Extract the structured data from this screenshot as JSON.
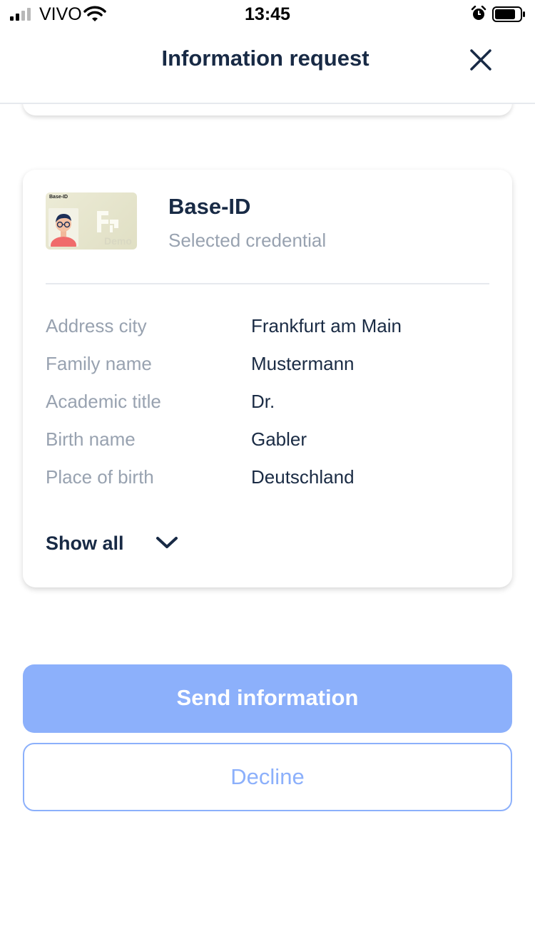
{
  "status_bar": {
    "carrier": "VIVO",
    "time": "13:45",
    "signal_bars_active": 2,
    "signal_bars_total": 4,
    "battery_level": 0.75
  },
  "header": {
    "title": "Information request",
    "close_icon": "close-icon"
  },
  "credential": {
    "thumbnail": {
      "label": "Base-ID",
      "watermark": "Demo"
    },
    "name": "Base-ID",
    "subtitle": "Selected credential",
    "attributes": [
      {
        "label": "Address city",
        "value": "Frankfurt am Main"
      },
      {
        "label": "Family name",
        "value": "Mustermann"
      },
      {
        "label": "Academic title",
        "value": "Dr."
      },
      {
        "label": "Birth name",
        "value": "Gabler"
      },
      {
        "label": "Place of birth",
        "value": "Deutschland"
      }
    ],
    "show_all_label": "Show all",
    "show_all_icon": "chevron-down-icon"
  },
  "actions": {
    "send_label": "Send information",
    "decline_label": "Decline"
  },
  "colors": {
    "primary_light": "#8cb0fb",
    "text_dark": "#182a45",
    "text_muted": "#98a2b0"
  }
}
